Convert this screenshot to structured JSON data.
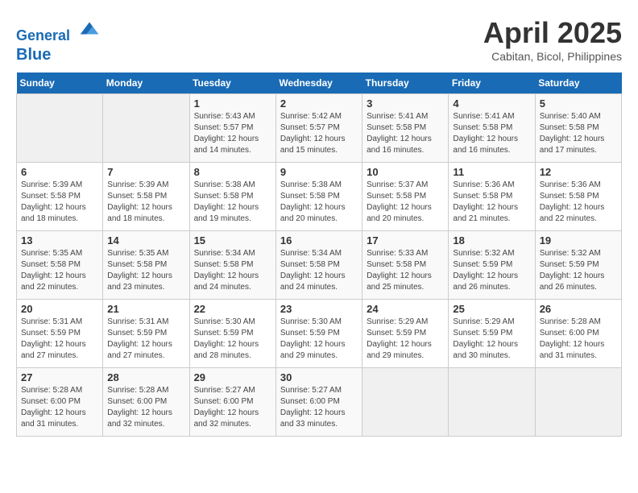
{
  "header": {
    "logo_line1": "General",
    "logo_line2": "Blue",
    "month": "April 2025",
    "location": "Cabitan, Bicol, Philippines"
  },
  "weekdays": [
    "Sunday",
    "Monday",
    "Tuesday",
    "Wednesday",
    "Thursday",
    "Friday",
    "Saturday"
  ],
  "weeks": [
    [
      null,
      null,
      {
        "day": 1,
        "sunrise": "5:43 AM",
        "sunset": "5:57 PM",
        "daylight": "12 hours and 14 minutes."
      },
      {
        "day": 2,
        "sunrise": "5:42 AM",
        "sunset": "5:57 PM",
        "daylight": "12 hours and 15 minutes."
      },
      {
        "day": 3,
        "sunrise": "5:41 AM",
        "sunset": "5:58 PM",
        "daylight": "12 hours and 16 minutes."
      },
      {
        "day": 4,
        "sunrise": "5:41 AM",
        "sunset": "5:58 PM",
        "daylight": "12 hours and 16 minutes."
      },
      {
        "day": 5,
        "sunrise": "5:40 AM",
        "sunset": "5:58 PM",
        "daylight": "12 hours and 17 minutes."
      }
    ],
    [
      {
        "day": 6,
        "sunrise": "5:39 AM",
        "sunset": "5:58 PM",
        "daylight": "12 hours and 18 minutes."
      },
      {
        "day": 7,
        "sunrise": "5:39 AM",
        "sunset": "5:58 PM",
        "daylight": "12 hours and 18 minutes."
      },
      {
        "day": 8,
        "sunrise": "5:38 AM",
        "sunset": "5:58 PM",
        "daylight": "12 hours and 19 minutes."
      },
      {
        "day": 9,
        "sunrise": "5:38 AM",
        "sunset": "5:58 PM",
        "daylight": "12 hours and 20 minutes."
      },
      {
        "day": 10,
        "sunrise": "5:37 AM",
        "sunset": "5:58 PM",
        "daylight": "12 hours and 20 minutes."
      },
      {
        "day": 11,
        "sunrise": "5:36 AM",
        "sunset": "5:58 PM",
        "daylight": "12 hours and 21 minutes."
      },
      {
        "day": 12,
        "sunrise": "5:36 AM",
        "sunset": "5:58 PM",
        "daylight": "12 hours and 22 minutes."
      }
    ],
    [
      {
        "day": 13,
        "sunrise": "5:35 AM",
        "sunset": "5:58 PM",
        "daylight": "12 hours and 22 minutes."
      },
      {
        "day": 14,
        "sunrise": "5:35 AM",
        "sunset": "5:58 PM",
        "daylight": "12 hours and 23 minutes."
      },
      {
        "day": 15,
        "sunrise": "5:34 AM",
        "sunset": "5:58 PM",
        "daylight": "12 hours and 24 minutes."
      },
      {
        "day": 16,
        "sunrise": "5:34 AM",
        "sunset": "5:58 PM",
        "daylight": "12 hours and 24 minutes."
      },
      {
        "day": 17,
        "sunrise": "5:33 AM",
        "sunset": "5:58 PM",
        "daylight": "12 hours and 25 minutes."
      },
      {
        "day": 18,
        "sunrise": "5:32 AM",
        "sunset": "5:59 PM",
        "daylight": "12 hours and 26 minutes."
      },
      {
        "day": 19,
        "sunrise": "5:32 AM",
        "sunset": "5:59 PM",
        "daylight": "12 hours and 26 minutes."
      }
    ],
    [
      {
        "day": 20,
        "sunrise": "5:31 AM",
        "sunset": "5:59 PM",
        "daylight": "12 hours and 27 minutes."
      },
      {
        "day": 21,
        "sunrise": "5:31 AM",
        "sunset": "5:59 PM",
        "daylight": "12 hours and 27 minutes."
      },
      {
        "day": 22,
        "sunrise": "5:30 AM",
        "sunset": "5:59 PM",
        "daylight": "12 hours and 28 minutes."
      },
      {
        "day": 23,
        "sunrise": "5:30 AM",
        "sunset": "5:59 PM",
        "daylight": "12 hours and 29 minutes."
      },
      {
        "day": 24,
        "sunrise": "5:29 AM",
        "sunset": "5:59 PM",
        "daylight": "12 hours and 29 minutes."
      },
      {
        "day": 25,
        "sunrise": "5:29 AM",
        "sunset": "5:59 PM",
        "daylight": "12 hours and 30 minutes."
      },
      {
        "day": 26,
        "sunrise": "5:28 AM",
        "sunset": "6:00 PM",
        "daylight": "12 hours and 31 minutes."
      }
    ],
    [
      {
        "day": 27,
        "sunrise": "5:28 AM",
        "sunset": "6:00 PM",
        "daylight": "12 hours and 31 minutes."
      },
      {
        "day": 28,
        "sunrise": "5:28 AM",
        "sunset": "6:00 PM",
        "daylight": "12 hours and 32 minutes."
      },
      {
        "day": 29,
        "sunrise": "5:27 AM",
        "sunset": "6:00 PM",
        "daylight": "12 hours and 32 minutes."
      },
      {
        "day": 30,
        "sunrise": "5:27 AM",
        "sunset": "6:00 PM",
        "daylight": "12 hours and 33 minutes."
      },
      null,
      null,
      null
    ]
  ]
}
